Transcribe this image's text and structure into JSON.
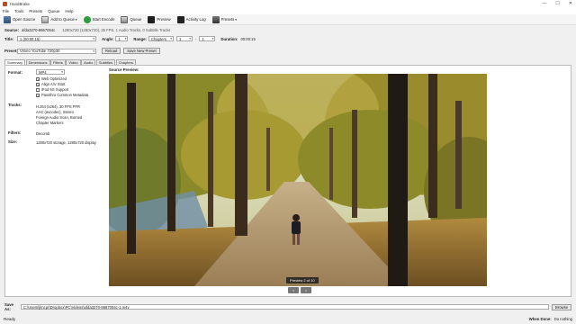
{
  "window": {
    "title": "HandBrake",
    "minimize": "—",
    "maximize": "☐",
    "close": "✕"
  },
  "menu": [
    "File",
    "Tools",
    "Presets",
    "Queue",
    "Help"
  ],
  "toolbar": {
    "open_source": "Open Source",
    "add_to_queue": "Add to Queue",
    "start_encode": "Start Encode",
    "queue": "Queue",
    "preview": "Preview",
    "activity_log": "Activity Log",
    "presets": "Presets"
  },
  "source": {
    "label": "Source:",
    "value": "afda3270-8667054c",
    "info": "1280x720 (1280x720), 25 FPS, 1 Audio Tracks, 0 Subtitle Tracks"
  },
  "title_row": {
    "title_label": "Title:",
    "title_value": "1 (00:00:15)",
    "angle_label": "Angle:",
    "angle_value": "1",
    "range_label": "Range:",
    "range_type": "Chapters",
    "range_start": "1",
    "range_sep": "-",
    "range_end": "1",
    "duration_label": "Duration:",
    "duration_value": "00:00:15"
  },
  "preset_row": {
    "label": "Preset:",
    "value": "Vimeo YouTube 720p30",
    "reload": "Reload",
    "save_new": "Save New Preset"
  },
  "tabs": [
    "Summary",
    "Dimensions",
    "Filters",
    "Video",
    "Audio",
    "Subtitles",
    "Chapters"
  ],
  "summary": {
    "format_label": "Format:",
    "format_value": "MP4",
    "options": [
      {
        "label": "Web Optimized",
        "checked": true
      },
      {
        "label": "Align A/V Start",
        "checked": true
      },
      {
        "label": "iPod 5G Support",
        "checked": false
      },
      {
        "label": "Passthru Common Metadata",
        "checked": true
      }
    ],
    "tracks_label": "Tracks:",
    "tracks": [
      "H.264 (x264), 30 FPS PFR",
      "AAC (avcodec), Stereo",
      "Foreign Audio Scan, Burned",
      "Chapter Markers"
    ],
    "filters_label": "Filters:",
    "filters_value": "Decomb",
    "size_label": "Size:",
    "size_value": "1280x720 storage, 1280x720 display"
  },
  "preview": {
    "label": "Source Preview:",
    "badge": "Preview 2 of 10",
    "prev": "<",
    "next": ">"
  },
  "save_as": {
    "label": "Save As:",
    "path": "C:\\Users\\jlmcpr\\Dropbox\\PC\\Videos\\afda3270-8667054c-1.m4v",
    "browse": "Browse"
  },
  "status": {
    "left": "Ready",
    "when_done_label": "When Done:",
    "when_done_value": "Do nothing"
  }
}
